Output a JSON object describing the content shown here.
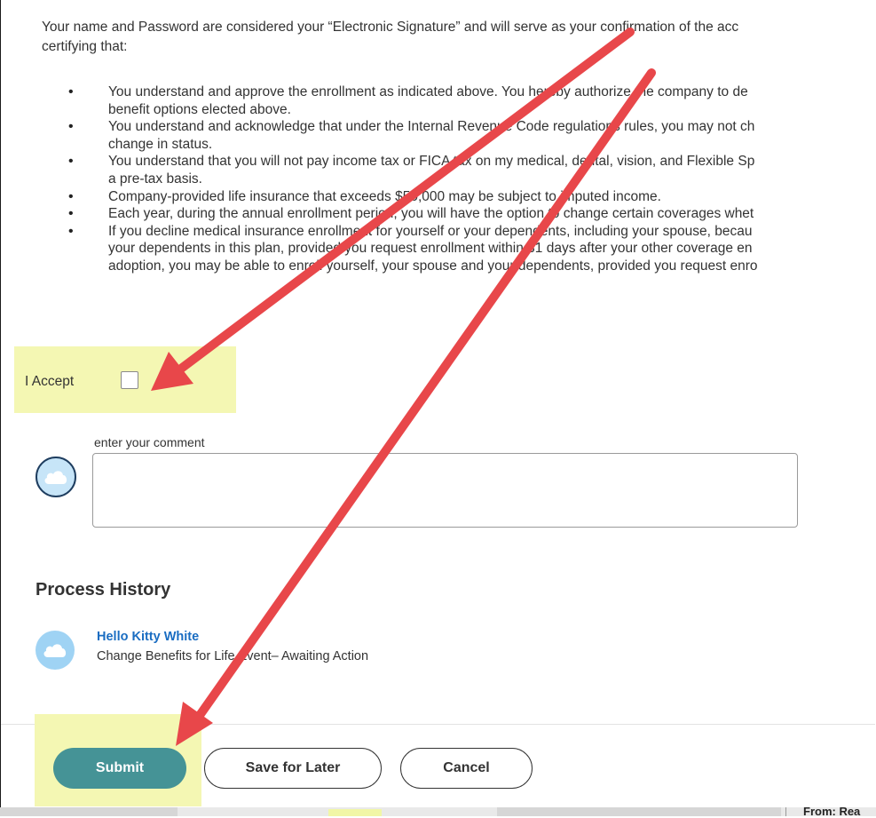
{
  "intro": {
    "line1": "Your name and Password are considered your “Electronic Signature” and will serve as your confirmation of the acc",
    "line2": "certifying that:"
  },
  "bullets": [
    {
      "line1": "You understand and approve the enrollment as indicated above. You hereby authorize the company to de",
      "line2": "benefit options elected above."
    },
    {
      "line1": "You understand and acknowledge that under the Internal Revenue Code regulations rules, you may not ch",
      "line2": "change in status."
    },
    {
      "line1": "You understand that you will not pay income tax or FICA tax on my medical, dental, vision, and Flexible Sp",
      "line2": "a pre-tax basis."
    },
    {
      "line1": "Company-provided life insurance that exceeds $50,000 may be subject to imputed income."
    },
    {
      "line1": "Each year, during the annual enrollment period, you will have the option to change certain coverages whet"
    },
    {
      "line1": "If you decline medical insurance enrollment for yourself or your dependents, including your spouse, becau",
      "line2": "your dependents in this plan, provided you request enrollment within 31 days after your other coverage en",
      "line3": "adoption, you may be able to enroll yourself, your spouse and your dependents, provided you request enro"
    }
  ],
  "accept": {
    "label": "I Accept",
    "checked": false
  },
  "comment": {
    "label": "enter your comment",
    "value": "",
    "avatar_icon": "cloud-icon"
  },
  "process_history": {
    "title": "Process History",
    "entries": [
      {
        "name": "Hello Kitty White",
        "description": "Change Benefits for Life Event– Awaiting Action",
        "avatar_icon": "cloud-icon"
      }
    ]
  },
  "actions": {
    "submit": "Submit",
    "save_for_later": "Save for Later",
    "cancel": "Cancel"
  },
  "footer": {
    "partial_text": "From: Rea"
  },
  "colors": {
    "submit_bg": "#459396",
    "highlight": "#f4f7b3",
    "annotation_arrow": "#e8474a",
    "link": "#1a6dc2"
  }
}
